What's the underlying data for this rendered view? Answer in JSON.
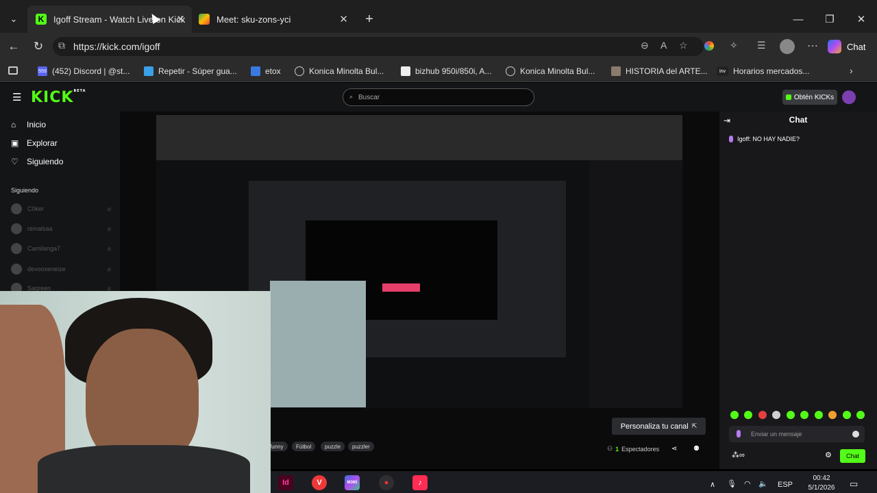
{
  "browser": {
    "tabs": [
      {
        "title": "Igoff Stream - Watch Live on Kick",
        "active": true,
        "favicon": "kick-icon"
      },
      {
        "title": "Meet: sku-zons-yci",
        "active": false,
        "favicon": "meet-icon"
      }
    ],
    "url": "https://kick.com/igoff",
    "copilot_label": "Chat",
    "bookmarks": [
      {
        "label": "(452) Discord | @st...",
        "icon": "discord-icon",
        "badge": "559"
      },
      {
        "label": "Repetir - Súper gua...",
        "icon": "bookmark-icon"
      },
      {
        "label": "etox",
        "icon": "lock-icon"
      },
      {
        "label": "Konica Minolta Bul...",
        "icon": "globe-icon"
      },
      {
        "label": "bizhub 950i/850i, A...",
        "icon": "doc-icon"
      },
      {
        "label": "Konica Minolta Bul...",
        "icon": "globe-icon"
      },
      {
        "label": "HISTORIA del ARTE...",
        "icon": "image-icon"
      },
      {
        "label": "Horarios mercados...",
        "icon": "inv-icon",
        "badge": "Inv"
      }
    ]
  },
  "kick": {
    "logo": "KICK",
    "logo_badge": "BETA",
    "search_placeholder": "Buscar",
    "get_kicks": "Obtén KICKs",
    "nav": [
      {
        "label": "Inicio",
        "icon": "home-icon"
      },
      {
        "label": "Explorar",
        "icon": "compass-icon"
      },
      {
        "label": "Siguiendo",
        "icon": "heart-icon"
      }
    ],
    "following_heading": "Siguiendo",
    "following": [
      "C0ker",
      "reinalsaa",
      "Camilanga7",
      "devooxeneize",
      "Sagreen"
    ],
    "chat": {
      "title": "Chat",
      "messages": [
        {
          "user": "Igoff",
          "text": "NO HAY NADIE?"
        }
      ],
      "input_placeholder": "Enviar un mensaje",
      "send_label": "Chat"
    },
    "customize_label": "Personaliza tu canal",
    "tags": [
      "funny",
      "Fútbol",
      "puzzle",
      "puzzler"
    ],
    "viewers_count": "1",
    "viewers_label": "Espectadores"
  },
  "taskbar": {
    "apps": [
      {
        "name": "indesign-icon",
        "label": "Id",
        "color": "#49021f"
      },
      {
        "name": "vivaldi-icon",
        "label": "V",
        "color": "#ef3939"
      },
      {
        "name": "m365-icon",
        "label": "M365",
        "color": "#3a6fd8"
      },
      {
        "name": "obs-icon",
        "label": "●",
        "color": "#302e31"
      },
      {
        "name": "tiktok-icon",
        "label": "♪",
        "color": "#fe2c55"
      }
    ],
    "lang": "ESP",
    "time": "00:42",
    "date": "5/1/2026"
  }
}
